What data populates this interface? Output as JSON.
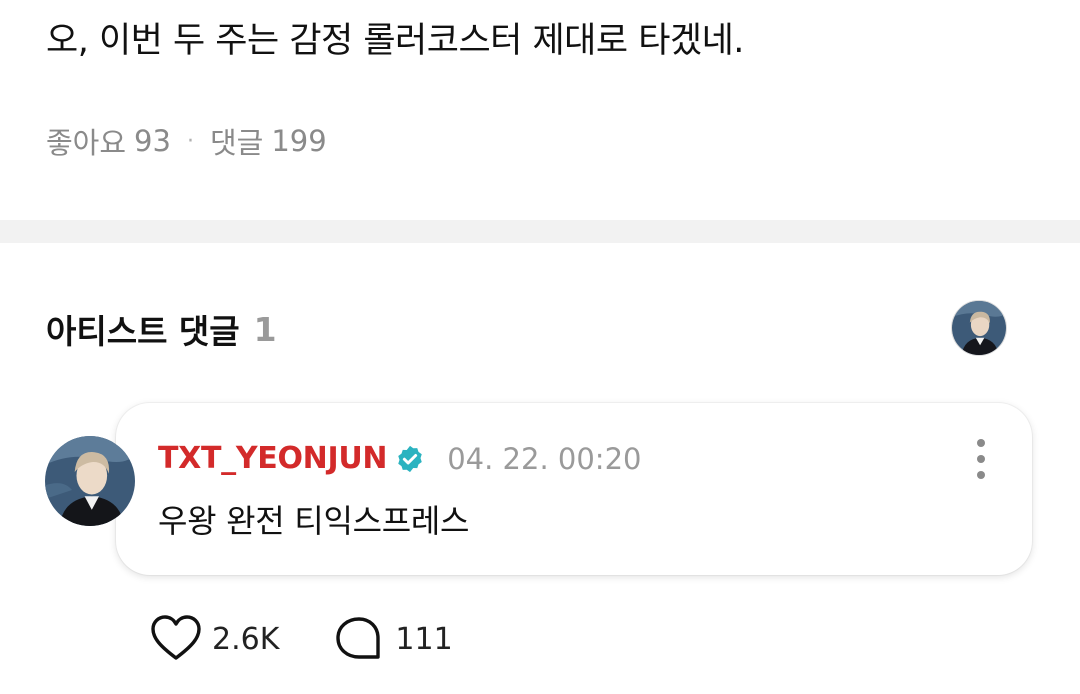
{
  "post": {
    "text": "오, 이번 두 주는 감정 롤러코스터 제대로 타겠네.",
    "likes_label": "좋아요",
    "likes_count": "93",
    "separator": "·",
    "comments_label": "댓글",
    "comments_count": "199"
  },
  "artist_comments": {
    "title": "아티스트 댓글",
    "count": "1"
  },
  "comment": {
    "username": "TXT_YEONJUN",
    "timestamp": "04. 22. 00:20",
    "body": "우왕 완전 티익스프레스",
    "likes": "2.6K",
    "replies": "111"
  },
  "colors": {
    "username": "#d32a2a",
    "verified": "#2bb3c0",
    "divider": "#f2f2f2"
  },
  "icons": {
    "verified": "verified-badge-icon",
    "more": "more-vertical-icon",
    "like": "heart-icon",
    "reply": "speech-bubble-icon"
  }
}
